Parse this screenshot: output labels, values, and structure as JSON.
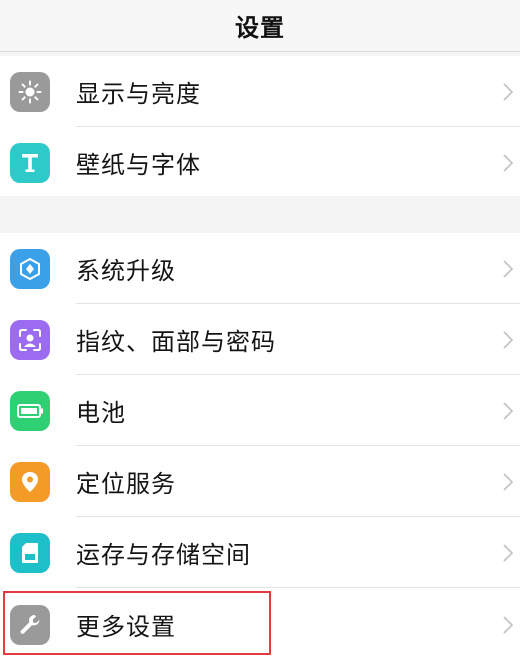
{
  "header": {
    "title": "设置"
  },
  "settings": {
    "display": {
      "label": "显示与亮度",
      "icon": "sun-brightness-icon",
      "color": "#9a9a9a"
    },
    "wallpaper": {
      "label": "壁纸与字体",
      "icon": "letter-t-icon",
      "color": "#2ec9c9"
    },
    "update": {
      "label": "系统升级",
      "icon": "system-update-icon",
      "color": "#3aa0e8"
    },
    "biometrics": {
      "label": "指纹、面部与密码",
      "icon": "face-scan-icon",
      "color": "#9b6cf0"
    },
    "battery": {
      "label": "电池",
      "icon": "battery-icon",
      "color": "#2fcf73"
    },
    "location": {
      "label": "定位服务",
      "icon": "location-pin-icon",
      "color": "#f49a26"
    },
    "storage": {
      "label": "运存与存储空间",
      "icon": "sd-card-icon",
      "color": "#1fbfc9"
    },
    "more": {
      "label": "更多设置",
      "icon": "wrench-icon",
      "color": "#9a9a9a"
    }
  },
  "highlight_color": "#e23c3c"
}
